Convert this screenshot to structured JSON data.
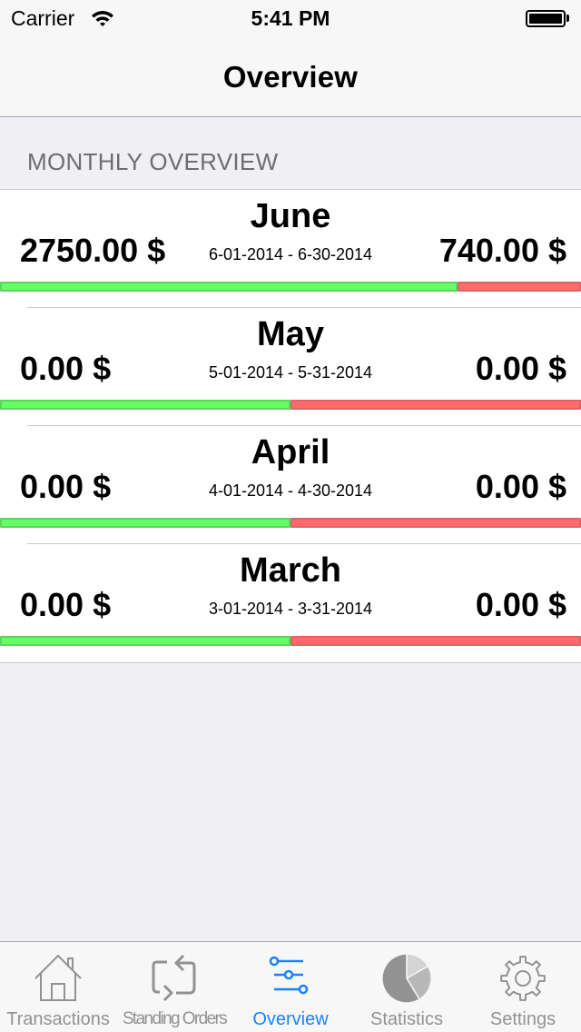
{
  "status_bar": {
    "carrier": "Carrier",
    "time": "5:41 PM",
    "battery_level": 1.0
  },
  "nav": {
    "title": "Overview"
  },
  "section": {
    "header": "MONTHLY OVERVIEW"
  },
  "colors": {
    "income": "#66fe66",
    "expense": "#ff6a6a",
    "accent": "#1a82fb",
    "tab_inactive": "#929292"
  },
  "months": [
    {
      "name": "June",
      "income": "2750.00 $",
      "expense": "740.00 $",
      "period": "6-01-2014 - 6-30-2014",
      "income_value": 2750,
      "expense_value": 740,
      "income_fraction": 0.788
    },
    {
      "name": "May",
      "income": "0.00 $",
      "expense": "0.00 $",
      "period": "5-01-2014 - 5-31-2014",
      "income_value": 0,
      "expense_value": 0,
      "income_fraction": 0.5
    },
    {
      "name": "April",
      "income": "0.00 $",
      "expense": "0.00 $",
      "period": "4-01-2014 - 4-30-2014",
      "income_value": 0,
      "expense_value": 0,
      "income_fraction": 0.5
    },
    {
      "name": "March",
      "income": "0.00 $",
      "expense": "0.00 $",
      "period": "3-01-2014 - 3-31-2014",
      "income_value": 0,
      "expense_value": 0,
      "income_fraction": 0.5
    }
  ],
  "tabs": [
    {
      "label": "Transactions",
      "icon": "house-icon",
      "active": false
    },
    {
      "label": "Standing Orders",
      "icon": "repeat-icon",
      "active": false
    },
    {
      "label": "Overview",
      "icon": "sliders-icon",
      "active": true
    },
    {
      "label": "Statistics",
      "icon": "pie-chart-icon",
      "active": false
    },
    {
      "label": "Settings",
      "icon": "gear-icon",
      "active": false
    }
  ]
}
